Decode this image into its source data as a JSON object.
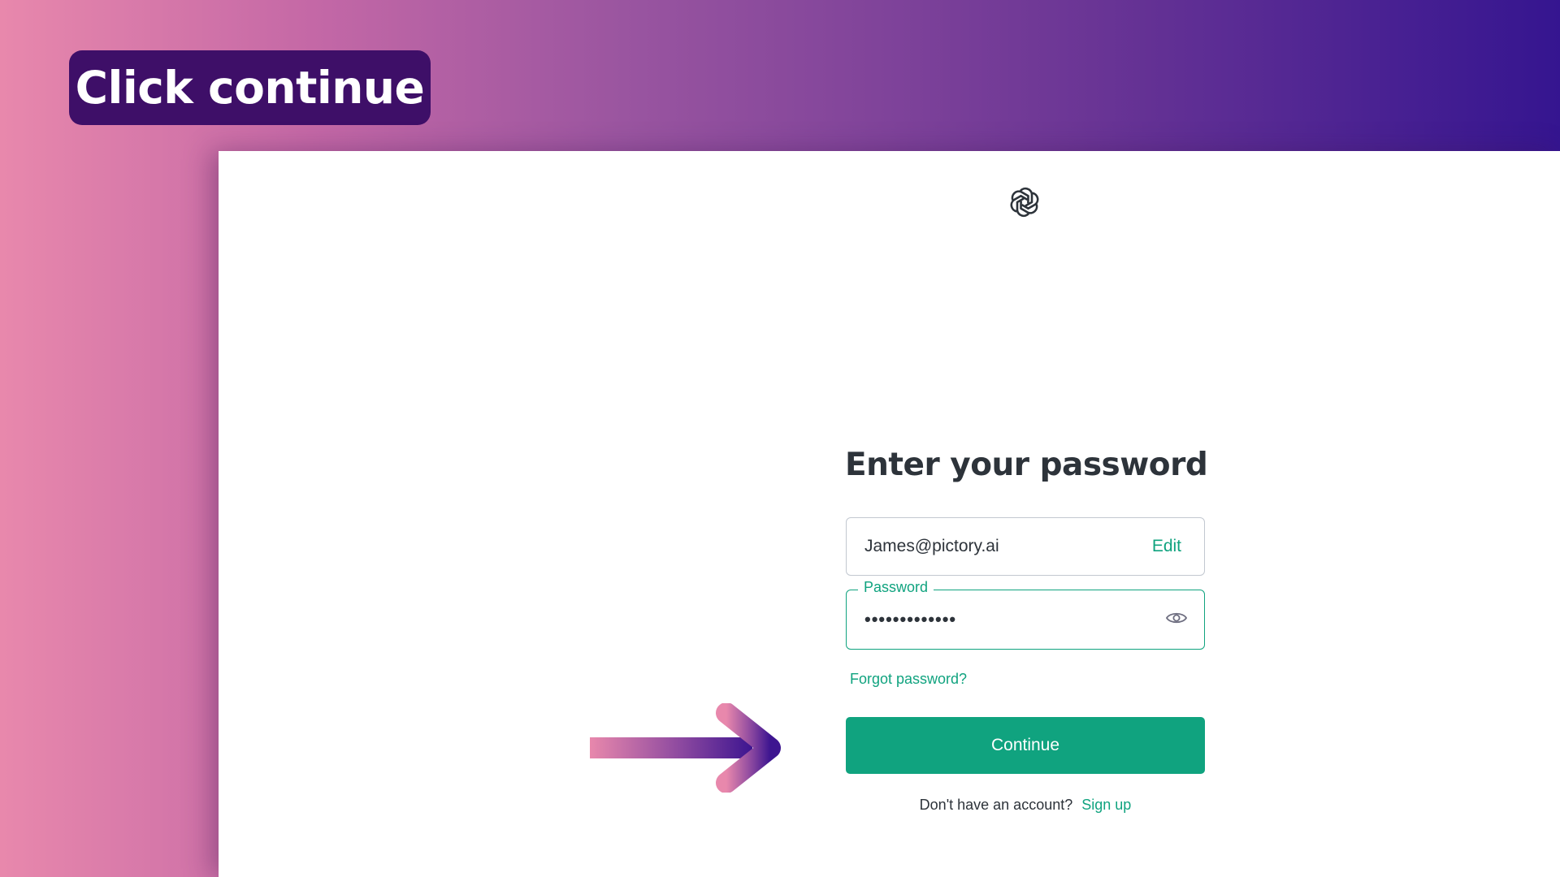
{
  "instruction": {
    "text": "Click continue"
  },
  "login": {
    "logo_icon": "openai-logo-icon",
    "title": "Enter your password",
    "email": {
      "value": "James@pictory.ai",
      "edit_label": "Edit"
    },
    "password": {
      "label": "Password",
      "masked_value": "•••••••••••••",
      "toggle_icon": "eye-icon"
    },
    "forgot_password_label": "Forgot password?",
    "continue_label": "Continue",
    "signup_prompt": "Don't have an account?",
    "signup_label": "Sign up"
  },
  "annotation": {
    "arrow_icon": "arrow-right-icon"
  },
  "colors": {
    "accent": "#10a37f",
    "badge_background": "#3e0f68",
    "text": "#2d333a",
    "gradient_start": "#e888ac",
    "gradient_end": "#351590"
  }
}
